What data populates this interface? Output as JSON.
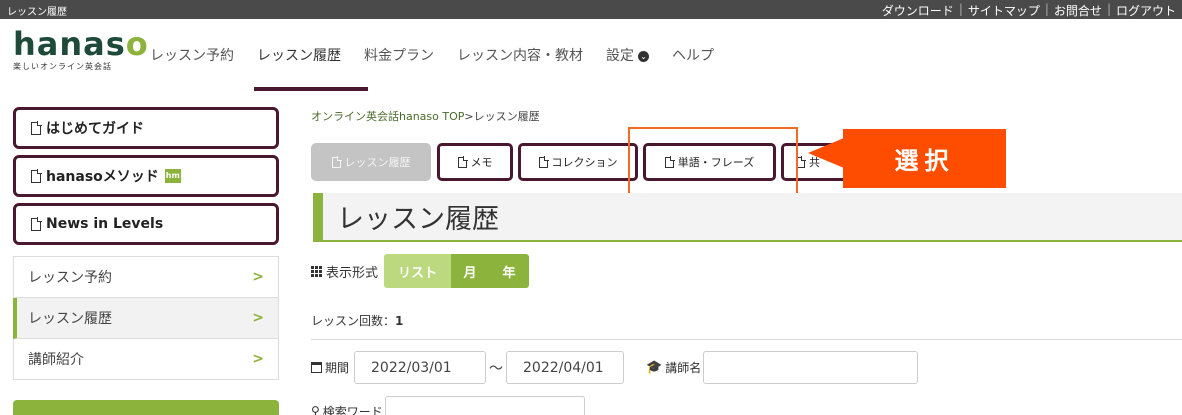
{
  "topbar": {
    "site_label": "レッスン履歴",
    "links": [
      "ダウンロード",
      "サイトマップ",
      "お問合せ",
      "ログアウト"
    ]
  },
  "logo": {
    "word_main": "hanas",
    "word_dot": "o",
    "tagline": "楽しいオンライン英会話"
  },
  "global_nav": {
    "items": [
      "レッスン予約",
      "レッスン履歴",
      "料金プラン",
      "レッスン内容・教材",
      "設定",
      "ヘルプ"
    ],
    "active": "レッスン履歴"
  },
  "sidebar": {
    "buttons": [
      "はじめてガイド",
      "hanasoメソッド",
      "News in Levels"
    ],
    "badge": "hm",
    "list": [
      "レッスン予約",
      "レッスン履歴",
      "講師紹介"
    ],
    "active": "レッスン履歴"
  },
  "breadcrumb": {
    "home": "オンライン英会話hanaso TOP",
    "sep": ">",
    "current": "レッスン履歴"
  },
  "tabs": [
    "レッスン履歴",
    "メモ",
    "コレクション",
    "単語・フレーズ",
    "共"
  ],
  "callout": {
    "text": "選択",
    "color": "#ff4d00"
  },
  "page_title": "レッスン履歴",
  "view": {
    "label": "表示形式",
    "options": [
      "リスト",
      "月",
      "年"
    ],
    "selected": "リスト"
  },
  "lesson_count": {
    "label": "レッスン回数：",
    "value": "1"
  },
  "filters": {
    "period_label": "期間",
    "from": "2022/03/01",
    "tilde": "〜",
    "to": "2022/04/01",
    "teacher_label": "講師名",
    "teacher_value": "",
    "keyword_label": "検索ワード",
    "keyword_value": ""
  },
  "colors": {
    "accent_green": "#8cb33b",
    "maroon": "#4a1730",
    "highlight": "#f26a24"
  }
}
